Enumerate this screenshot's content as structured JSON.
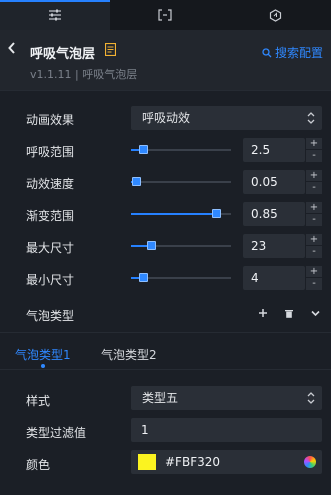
{
  "top_tabs": [
    {
      "icon": "sliders-icon",
      "active": true
    },
    {
      "icon": "bracket-interaction-icon",
      "active": false
    },
    {
      "icon": "hexagon-refresh-icon",
      "active": false
    }
  ],
  "header": {
    "title": "呼吸气泡层",
    "version": "v1.1.11 | 呼吸气泡层",
    "search_config": "搜索配置"
  },
  "settings": {
    "animation_effect": {
      "label": "动画效果",
      "value": "呼吸动效"
    },
    "breath_range": {
      "label": "呼吸范围",
      "value": "2.5",
      "level": 0.12
    },
    "anim_speed": {
      "label": "动效速度",
      "value": "0.05",
      "level": 0.05
    },
    "gradient_range": {
      "label": "渐变范围",
      "value": "0.85",
      "level": 0.85
    },
    "max_size": {
      "label": "最大尺寸",
      "value": "23",
      "level": 0.2
    },
    "min_size": {
      "label": "最小尺寸",
      "value": "4",
      "level": 0.12
    },
    "bubble_type": {
      "label": "气泡类型"
    }
  },
  "sub_tabs": [
    {
      "label": "气泡类型1",
      "active": true
    },
    {
      "label": "气泡类型2",
      "active": false
    }
  ],
  "bubble": {
    "style": {
      "label": "样式",
      "value": "类型五"
    },
    "filter": {
      "label": "类型过滤值",
      "value": "1"
    },
    "color": {
      "label": "颜色",
      "value": "#FBF320",
      "swatch": "#fbf320"
    }
  },
  "stepper": {
    "plus": "+",
    "minus": "-"
  },
  "colors": {
    "accent": "#2681ff",
    "panel": "#1b1f26",
    "input": "#2a2f37"
  }
}
